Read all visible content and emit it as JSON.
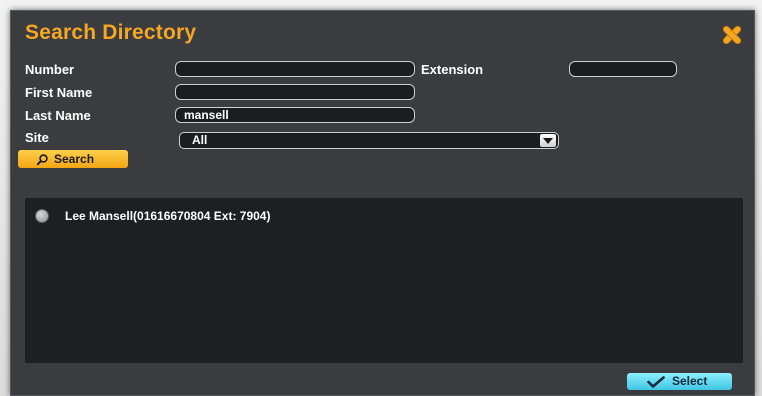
{
  "dialog": {
    "title": "Search Directory",
    "close_icon": "close-x-icon",
    "colors": {
      "title": "#f5a623",
      "search_button": "#f5b323",
      "select_button": "#5ad6f0",
      "panel": "#3a3c3f",
      "results_bg": "#1d1f21"
    }
  },
  "form": {
    "number_label": "Number",
    "number_value": "",
    "extension_label": "Extension",
    "extension_value": "",
    "first_name_label": "First Name",
    "first_name_value": "",
    "last_name_label": "Last Name",
    "last_name_value": "mansell",
    "site_label": "Site",
    "site_value": "All",
    "search_button_label": "Search",
    "search_icon": "magnifier-icon"
  },
  "results": {
    "items": [
      {
        "label": "Lee Mansell(01616670804 Ext: 7904)",
        "selected": false
      }
    ]
  },
  "footer": {
    "select_button_label": "Select",
    "select_icon": "checkmark-icon"
  }
}
